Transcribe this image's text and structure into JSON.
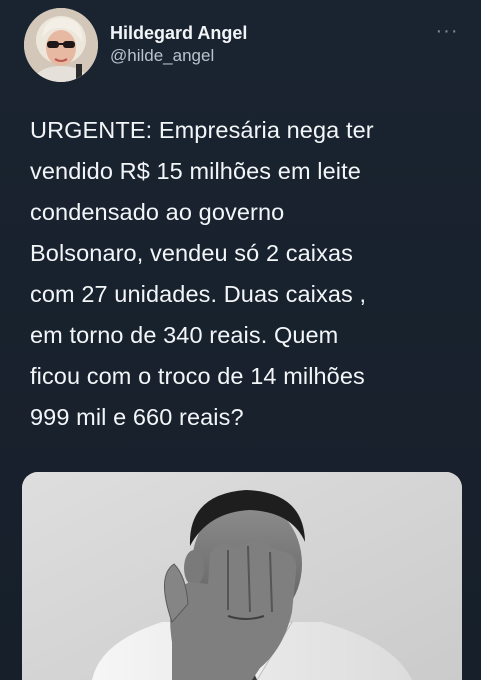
{
  "tweet": {
    "author": {
      "display_name": "Hildegard Angel",
      "handle": "@hilde_angel"
    },
    "more_label": "···",
    "text_lines": [
      "URGENTE: Empresária nega ter",
      "vendido R$ 15 milhões em leite",
      "condensado ao governo",
      "Bolsonaro, vendeu só 2 caixas",
      "com 27 unidades. Duas caixas ,",
      "em torno de 340 reais. Quem",
      "ficou com o troco de 14 milhões",
      "999 mil e 660 reais?"
    ]
  },
  "colors": {
    "background": "#15202b",
    "name": "#f2f5f7",
    "handle": "#b8c3cc",
    "text": "#f3f6f8"
  }
}
